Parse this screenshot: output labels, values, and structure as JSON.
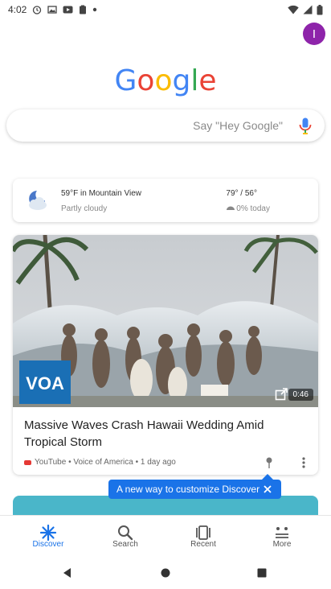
{
  "status_bar": {
    "time": "4:02"
  },
  "account": {
    "avatar_initial": "I",
    "avatar_color": "#8e24aa"
  },
  "logo": {
    "letters": [
      "G",
      "o",
      "o",
      "g",
      "l",
      "e"
    ],
    "colors": [
      "#4285f4",
      "#ea4335",
      "#fbbc05",
      "#4285f4",
      "#34a853",
      "#ea4335"
    ]
  },
  "search": {
    "placeholder": "Say \"Hey Google\"",
    "mic_icon": "mic-icon"
  },
  "weather": {
    "icon": "partly-cloudy-night-icon",
    "temperature_location": "59°F in Mountain View",
    "condition": "Partly cloudy",
    "hi_lo": "79° / 56°",
    "precipitation": "0% today"
  },
  "news": {
    "duration": "0:46",
    "title": "Massive Waves Crash Hawaii Wedding Amid Tropical Storm",
    "source": "YouTube • Voice of America • 1 day ago",
    "overlay_logo": "VOA"
  },
  "tooltip": {
    "text": "A new way to customize Discover"
  },
  "bottom_nav": {
    "items": [
      {
        "label": "Discover",
        "icon": "discover-icon",
        "active": true
      },
      {
        "label": "Search",
        "icon": "search-icon",
        "active": false
      },
      {
        "label": "Recent",
        "icon": "recent-icon",
        "active": false
      },
      {
        "label": "More",
        "icon": "more-grid-icon",
        "active": false
      }
    ]
  },
  "colors": {
    "accent": "#1a73e8",
    "youtube_red": "#e53935"
  }
}
